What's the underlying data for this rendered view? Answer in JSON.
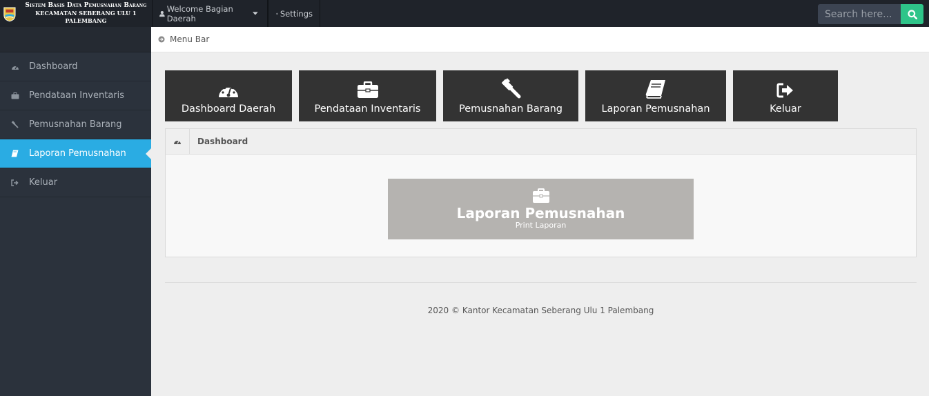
{
  "brand": {
    "line1": "Sistem Basis Data Pemusnahan Barang",
    "line2": "KECAMATAN SEBERANG ULU 1 PALEMBANG"
  },
  "topnav": {
    "welcome": "Welcome Bagian Daerah",
    "settings": "Settings",
    "search_placeholder": "Search here..."
  },
  "sidebar": {
    "items": [
      {
        "label": "Dashboard",
        "icon": "dashboard-icon"
      },
      {
        "label": "Pendataan Inventaris",
        "icon": "briefcase-icon"
      },
      {
        "label": "Pemusnahan Barang",
        "icon": "gavel-icon"
      },
      {
        "label": "Laporan Pemusnahan",
        "icon": "book-icon",
        "active": true
      },
      {
        "label": "Keluar",
        "icon": "sign-out-icon"
      }
    ]
  },
  "breadcrumb": {
    "label": "Menu Bar"
  },
  "tiles": [
    {
      "label": "Dashboard Daerah",
      "icon": "dashboard-icon"
    },
    {
      "label": "Pendataan Inventaris",
      "icon": "briefcase-icon"
    },
    {
      "label": "Pemusnahan Barang",
      "icon": "gavel-icon"
    },
    {
      "label": "Laporan Pemusnahan",
      "icon": "book-icon"
    },
    {
      "label": "Keluar",
      "icon": "sign-out-icon"
    }
  ],
  "panel": {
    "title": "Dashboard",
    "card_title": "Laporan Pemusnahan",
    "card_subtitle": "Print Laporan"
  },
  "footer": {
    "text": "2020 © Kantor Kecamatan Seberang Ulu 1 Palembang"
  },
  "colors": {
    "topbar": "#1f232a",
    "sidebar": "#2b323c",
    "active": "#2aace3",
    "search_button": "#2ec489",
    "tile": "#333333",
    "card": "#b5b3b0"
  }
}
